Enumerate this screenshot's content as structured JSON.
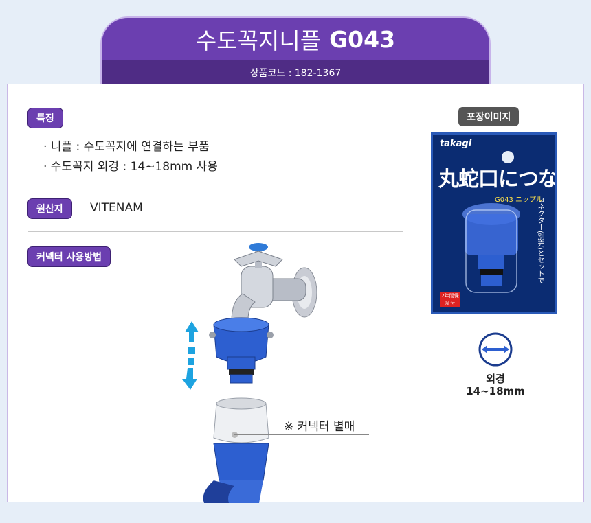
{
  "header": {
    "product_name": "수도꼭지니플",
    "model": "G043",
    "code_label": "상품코드 : 182-1367"
  },
  "features": {
    "label": "특징",
    "items": [
      "· 니플 : 수도꼭지에 연결하는 부품",
      "· 수도꼭지 외경 : 14~18mm 사용"
    ]
  },
  "origin": {
    "label": "원산지",
    "value": "VITENAM"
  },
  "usage": {
    "label": "커넥터 사용방법",
    "note": "※ 커넥터 별매"
  },
  "package": {
    "label": "포장이미지",
    "brand": "takagi",
    "headline": "丸蛇口につなぐ",
    "sub": "G043 ニップル",
    "side_text": "コネクター(別売)とセットで",
    "badge": "2年間保証付"
  },
  "outer_diameter": {
    "label": "외경",
    "value": "14~18mm"
  },
  "colors": {
    "accent_purple": "#6b3fb0",
    "accent_dark_purple": "#4f2c85",
    "arrow_blue": "#1da3e0",
    "product_blue": "#2d5fd0"
  }
}
